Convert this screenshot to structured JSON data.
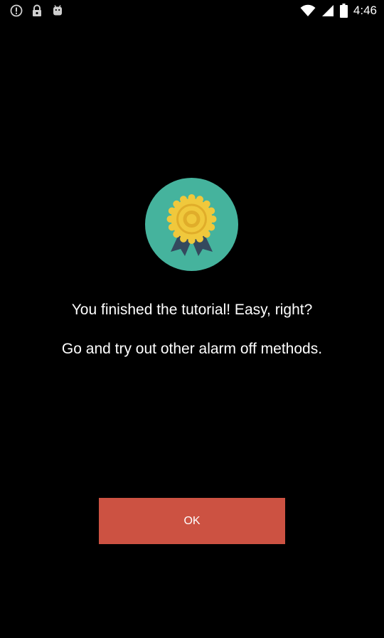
{
  "status_bar": {
    "icons_left": [
      "alert-circle-icon",
      "lock-icon",
      "android-icon"
    ],
    "icons_right": [
      "wifi-icon",
      "signal-icon",
      "battery-icon"
    ],
    "time": "4:46"
  },
  "badge": {
    "icon": "award-medal-icon",
    "colors": {
      "circle": "#45b39d",
      "medal": "#f0c83c",
      "ribbon": "#34495e"
    }
  },
  "message": {
    "line1": "You finished the tutorial! Easy, right?",
    "line2": "Go and try out other alarm off methods."
  },
  "ok_button": {
    "label": "OK",
    "color": "#cc5242"
  }
}
